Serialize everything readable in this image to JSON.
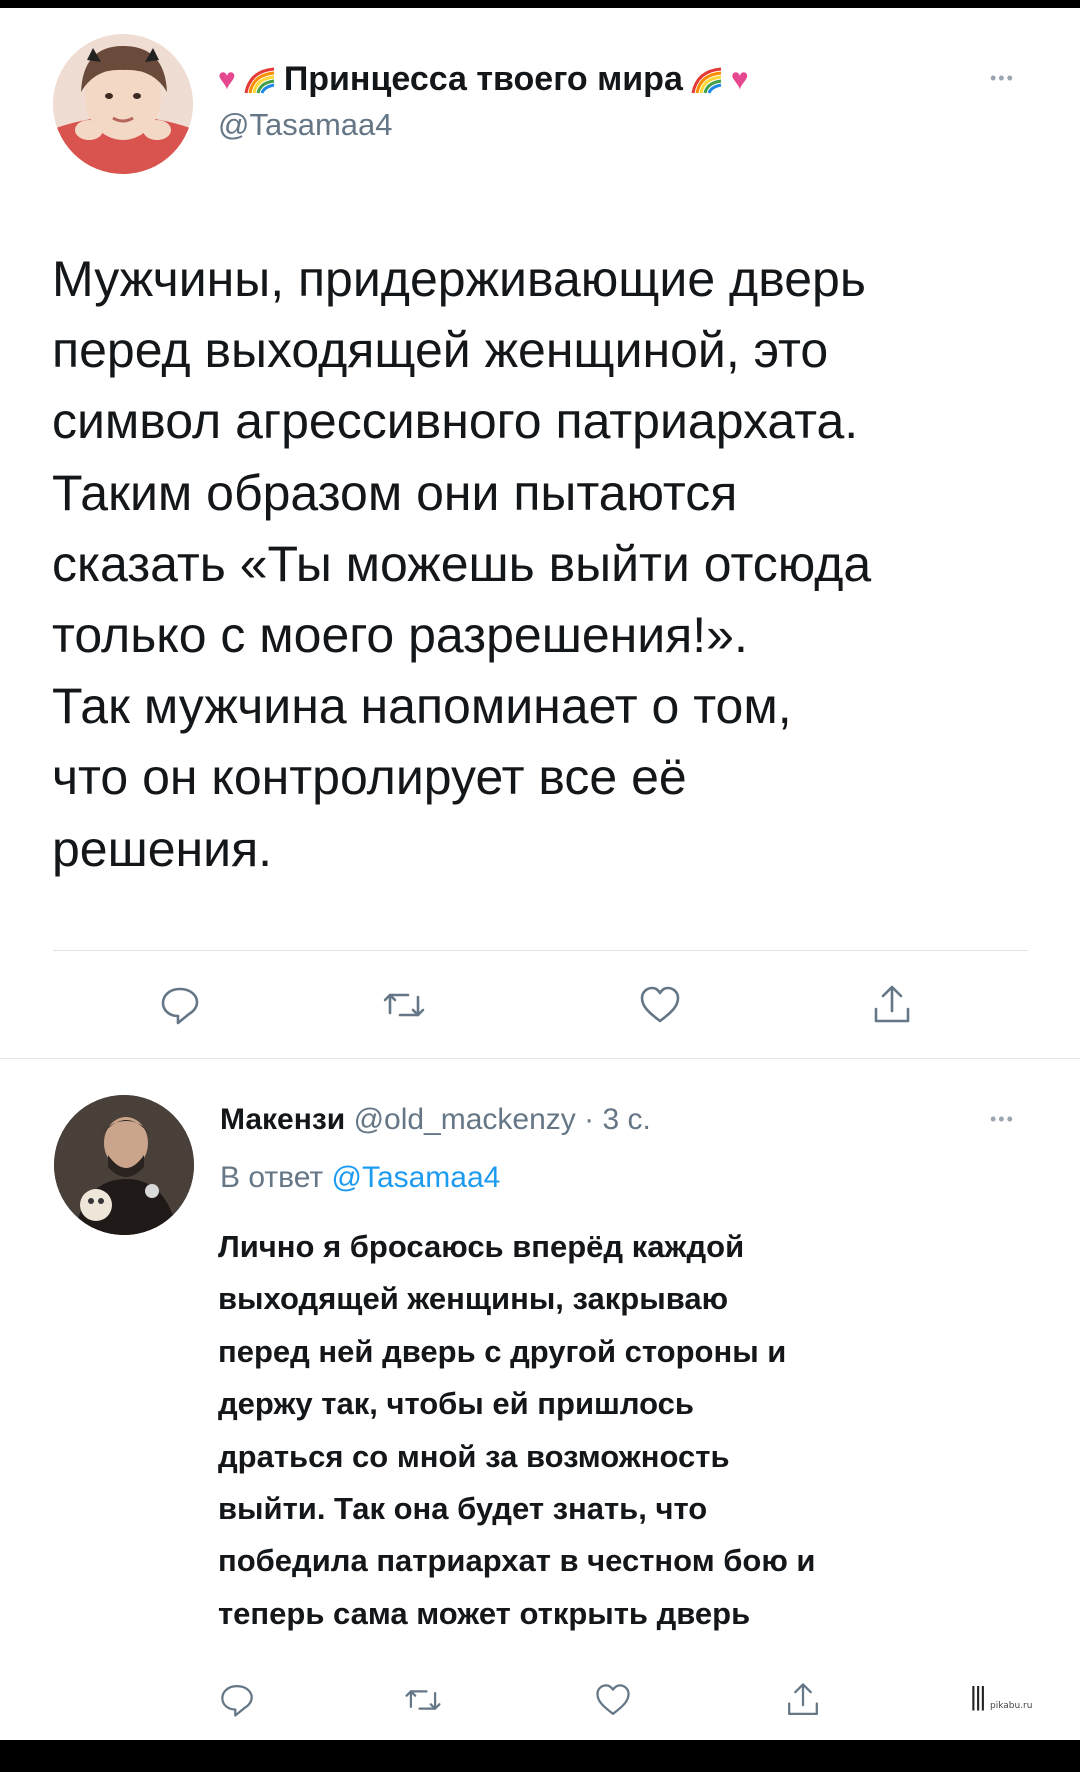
{
  "post": {
    "display_name": "Принцесса твоего мира",
    "handle": "@Tasamaa4",
    "text_lines": [
      "Мужчины, придерживающие дверь",
      "перед выходящей женщиной, это",
      "символ агрессивного патриархата.",
      "Таким образом они пытаются",
      "сказать «Ты можешь выйти отсюда",
      "только с моего разрешения!».",
      "Так мужчина напоминает о том,",
      "что он контролирует все её",
      "решения."
    ],
    "icons": [
      "reply-icon",
      "retweet-icon",
      "like-icon",
      "share-icon",
      "more-icon"
    ]
  },
  "reply": {
    "display_name": "Макензи",
    "handle": "@old_mackenzy",
    "time": "· 3 с.",
    "reply_to_prefix": "В ответ",
    "reply_to_handle": "@Tasamaa4",
    "text_lines": [
      "Лично я бросаюсь вперёд каждой",
      "выходящей женщины, закрываю",
      "перед ней дверь с другой стороны и",
      "держу так, чтобы ей пришлось",
      "драться со мной за возможность",
      "выйти. Так она будет знать, что",
      "победила патриархат в честном бою и",
      "теперь сама может открыть дверь"
    ]
  },
  "watermark": {
    "text": "pikabu.ru"
  },
  "colors": {
    "text": "#14171a",
    "muted": "#657786",
    "link": "#1d9bf0",
    "icon": "#657786"
  }
}
